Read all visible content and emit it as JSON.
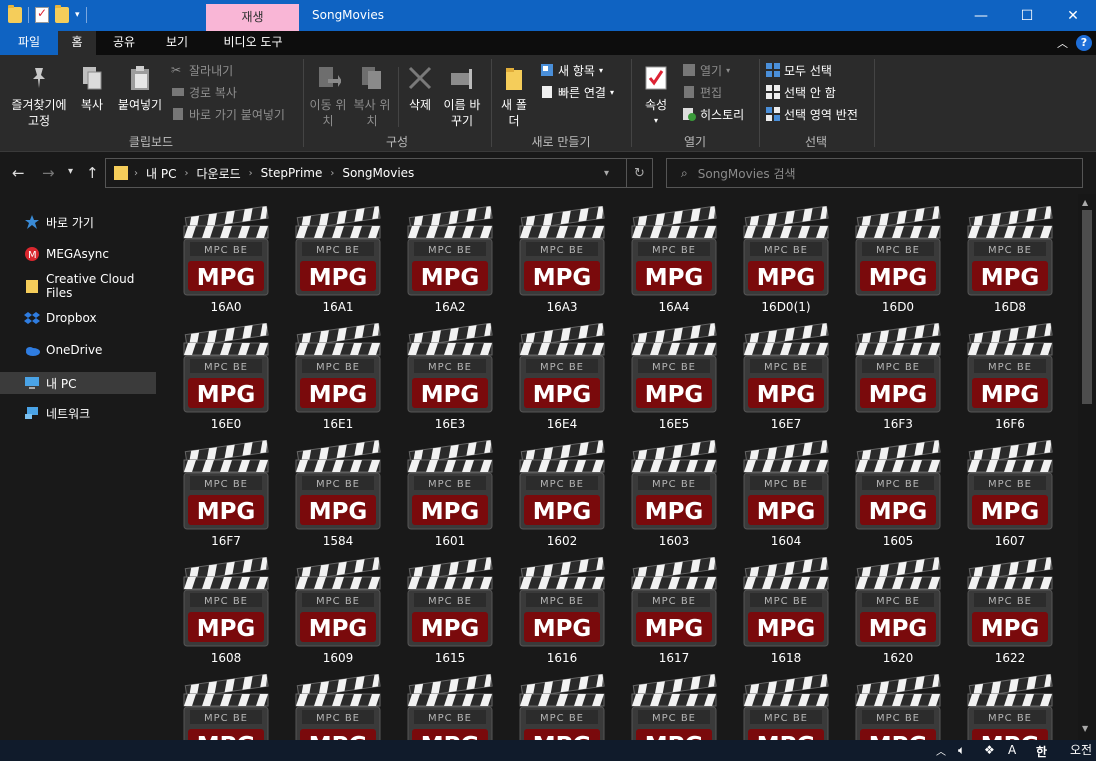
{
  "window": {
    "title": "SongMovies",
    "contextual_tab": "재생"
  },
  "ribbon_tabs": [
    "파일",
    "홈",
    "공유",
    "보기",
    "비디오 도구"
  ],
  "ribbon": {
    "clipboard": {
      "pin": "즐겨찾기에 고정",
      "copy": "복사",
      "paste": "붙여넣기",
      "cut": "잘라내기",
      "copy_path": "경로 복사",
      "paste_shortcut": "바로 가기 붙여넣기",
      "label": "클립보드"
    },
    "organize": {
      "move_to": "이동 위치",
      "copy_to": "복사 위치",
      "delete": "삭제",
      "rename": "이름 바꾸기",
      "label": "구성"
    },
    "new": {
      "new_folder": "새 폴더",
      "new_item": "새 항목",
      "easy_access": "빠른 연결",
      "label": "새로 만들기"
    },
    "open": {
      "properties": "속성",
      "open": "열기",
      "edit": "편집",
      "history": "히스토리",
      "label": "열기"
    },
    "select": {
      "select_all": "모두 선택",
      "select_none": "선택 안 함",
      "invert": "선택 영역 반전",
      "label": "선택"
    }
  },
  "address": {
    "crumbs": [
      "내 PC",
      "다운로드",
      "StepPrime",
      "SongMovies"
    ],
    "search_placeholder": "SongMovies 검색"
  },
  "nav": [
    {
      "label": "바로 가기",
      "icon": "star-icon"
    },
    {
      "label": "MEGAsync",
      "icon": "mega-icon"
    },
    {
      "label": "Creative Cloud Files",
      "icon": "cc-folder-icon"
    },
    {
      "label": "Dropbox",
      "icon": "dropbox-icon"
    },
    {
      "label": "OneDrive",
      "icon": "onedrive-icon"
    },
    {
      "label": "내 PC",
      "icon": "pc-icon"
    },
    {
      "label": "네트워크",
      "icon": "network-icon"
    }
  ],
  "file_icon": {
    "badge": "MPC BE",
    "format": "MPG"
  },
  "files": [
    "16A0",
    "16A1",
    "16A2",
    "16A3",
    "16A4",
    "16D0(1)",
    "16D0",
    "16D8",
    "16E0",
    "16E1",
    "16E3",
    "16E4",
    "16E5",
    "16E7",
    "16F3",
    "16F6",
    "16F7",
    "1584",
    "1601",
    "1602",
    "1603",
    "1604",
    "1605",
    "1607",
    "1608",
    "1609",
    "1615",
    "1616",
    "1617",
    "1618",
    "1620",
    "1622",
    "",
    "",
    "",
    "",
    "",
    "",
    "",
    ""
  ],
  "taskbar": {
    "clock": "오전",
    "ime": "한",
    "lang": "A"
  }
}
